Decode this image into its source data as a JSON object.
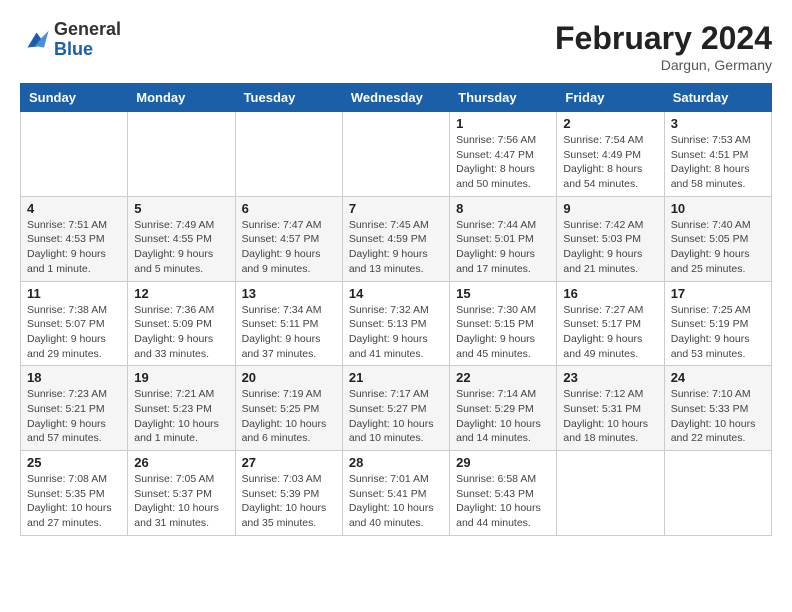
{
  "header": {
    "logo_line1": "General",
    "logo_line2": "Blue",
    "month": "February 2024",
    "location": "Dargun, Germany"
  },
  "weekdays": [
    "Sunday",
    "Monday",
    "Tuesday",
    "Wednesday",
    "Thursday",
    "Friday",
    "Saturday"
  ],
  "weeks": [
    [
      {
        "day": "",
        "info": ""
      },
      {
        "day": "",
        "info": ""
      },
      {
        "day": "",
        "info": ""
      },
      {
        "day": "",
        "info": ""
      },
      {
        "day": "1",
        "info": "Sunrise: 7:56 AM\nSunset: 4:47 PM\nDaylight: 8 hours\nand 50 minutes."
      },
      {
        "day": "2",
        "info": "Sunrise: 7:54 AM\nSunset: 4:49 PM\nDaylight: 8 hours\nand 54 minutes."
      },
      {
        "day": "3",
        "info": "Sunrise: 7:53 AM\nSunset: 4:51 PM\nDaylight: 8 hours\nand 58 minutes."
      }
    ],
    [
      {
        "day": "4",
        "info": "Sunrise: 7:51 AM\nSunset: 4:53 PM\nDaylight: 9 hours\nand 1 minute."
      },
      {
        "day": "5",
        "info": "Sunrise: 7:49 AM\nSunset: 4:55 PM\nDaylight: 9 hours\nand 5 minutes."
      },
      {
        "day": "6",
        "info": "Sunrise: 7:47 AM\nSunset: 4:57 PM\nDaylight: 9 hours\nand 9 minutes."
      },
      {
        "day": "7",
        "info": "Sunrise: 7:45 AM\nSunset: 4:59 PM\nDaylight: 9 hours\nand 13 minutes."
      },
      {
        "day": "8",
        "info": "Sunrise: 7:44 AM\nSunset: 5:01 PM\nDaylight: 9 hours\nand 17 minutes."
      },
      {
        "day": "9",
        "info": "Sunrise: 7:42 AM\nSunset: 5:03 PM\nDaylight: 9 hours\nand 21 minutes."
      },
      {
        "day": "10",
        "info": "Sunrise: 7:40 AM\nSunset: 5:05 PM\nDaylight: 9 hours\nand 25 minutes."
      }
    ],
    [
      {
        "day": "11",
        "info": "Sunrise: 7:38 AM\nSunset: 5:07 PM\nDaylight: 9 hours\nand 29 minutes."
      },
      {
        "day": "12",
        "info": "Sunrise: 7:36 AM\nSunset: 5:09 PM\nDaylight: 9 hours\nand 33 minutes."
      },
      {
        "day": "13",
        "info": "Sunrise: 7:34 AM\nSunset: 5:11 PM\nDaylight: 9 hours\nand 37 minutes."
      },
      {
        "day": "14",
        "info": "Sunrise: 7:32 AM\nSunset: 5:13 PM\nDaylight: 9 hours\nand 41 minutes."
      },
      {
        "day": "15",
        "info": "Sunrise: 7:30 AM\nSunset: 5:15 PM\nDaylight: 9 hours\nand 45 minutes."
      },
      {
        "day": "16",
        "info": "Sunrise: 7:27 AM\nSunset: 5:17 PM\nDaylight: 9 hours\nand 49 minutes."
      },
      {
        "day": "17",
        "info": "Sunrise: 7:25 AM\nSunset: 5:19 PM\nDaylight: 9 hours\nand 53 minutes."
      }
    ],
    [
      {
        "day": "18",
        "info": "Sunrise: 7:23 AM\nSunset: 5:21 PM\nDaylight: 9 hours\nand 57 minutes."
      },
      {
        "day": "19",
        "info": "Sunrise: 7:21 AM\nSunset: 5:23 PM\nDaylight: 10 hours\nand 1 minute."
      },
      {
        "day": "20",
        "info": "Sunrise: 7:19 AM\nSunset: 5:25 PM\nDaylight: 10 hours\nand 6 minutes."
      },
      {
        "day": "21",
        "info": "Sunrise: 7:17 AM\nSunset: 5:27 PM\nDaylight: 10 hours\nand 10 minutes."
      },
      {
        "day": "22",
        "info": "Sunrise: 7:14 AM\nSunset: 5:29 PM\nDaylight: 10 hours\nand 14 minutes."
      },
      {
        "day": "23",
        "info": "Sunrise: 7:12 AM\nSunset: 5:31 PM\nDaylight: 10 hours\nand 18 minutes."
      },
      {
        "day": "24",
        "info": "Sunrise: 7:10 AM\nSunset: 5:33 PM\nDaylight: 10 hours\nand 22 minutes."
      }
    ],
    [
      {
        "day": "25",
        "info": "Sunrise: 7:08 AM\nSunset: 5:35 PM\nDaylight: 10 hours\nand 27 minutes."
      },
      {
        "day": "26",
        "info": "Sunrise: 7:05 AM\nSunset: 5:37 PM\nDaylight: 10 hours\nand 31 minutes."
      },
      {
        "day": "27",
        "info": "Sunrise: 7:03 AM\nSunset: 5:39 PM\nDaylight: 10 hours\nand 35 minutes."
      },
      {
        "day": "28",
        "info": "Sunrise: 7:01 AM\nSunset: 5:41 PM\nDaylight: 10 hours\nand 40 minutes."
      },
      {
        "day": "29",
        "info": "Sunrise: 6:58 AM\nSunset: 5:43 PM\nDaylight: 10 hours\nand 44 minutes."
      },
      {
        "day": "",
        "info": ""
      },
      {
        "day": "",
        "info": ""
      }
    ]
  ]
}
